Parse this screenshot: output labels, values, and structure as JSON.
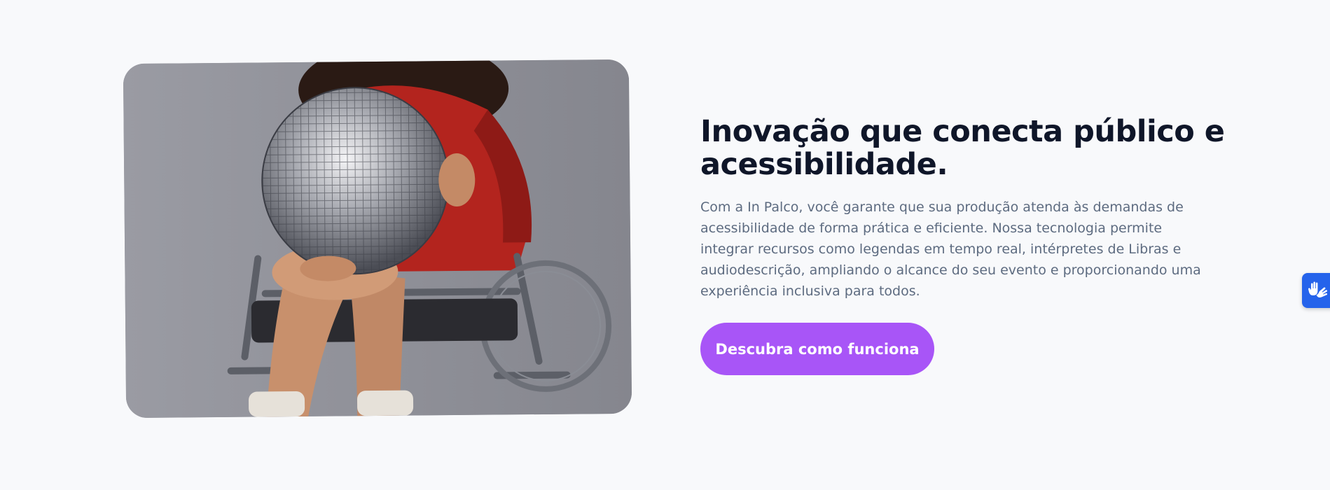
{
  "hero": {
    "image_alt": "Pessoa em cadeira de rodas segurando um globo espelhado",
    "title": "Inovação que conecta público e acessibilidade.",
    "description": "Com a In Palco, você garante que sua produção atenda às demandas de acessibilidade de forma prática e eficiente. Nossa tecnologia permite integrar recursos como legendas em tempo real, intérpretes de Libras e audiodescrição, ampliando o alcance do seu evento e proporcionando uma experiência inclusiva para todos.",
    "cta_label": "Descubra como funciona"
  },
  "widgets": {
    "accessibility_icon": "sign-language-hands-icon"
  },
  "colors": {
    "background": "#f8f9fb",
    "title": "#0f1629",
    "text": "#5d6b80",
    "accent": "#a855f7",
    "widget": "#2563eb"
  }
}
